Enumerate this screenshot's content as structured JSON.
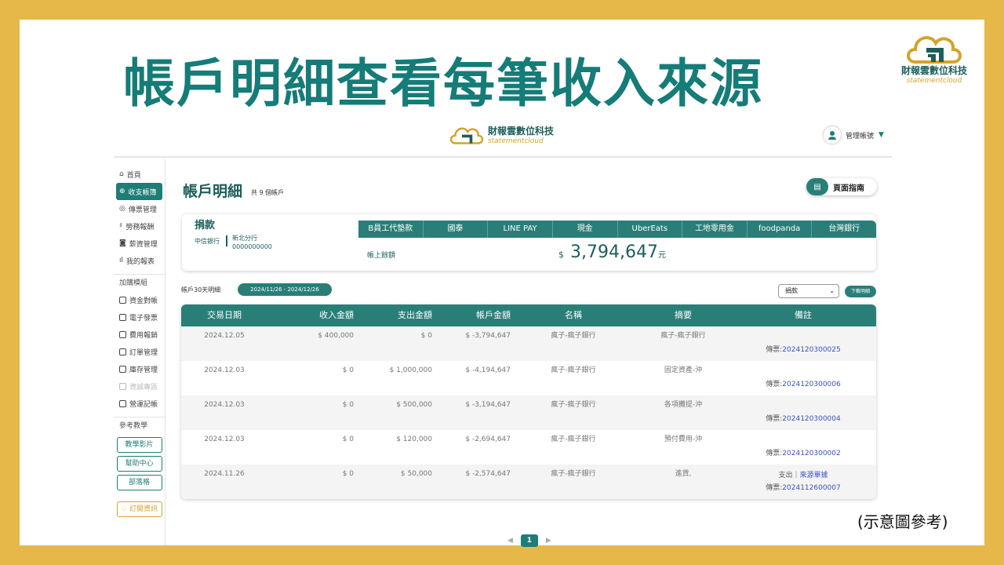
{
  "slide": {
    "headline": "帳戶明細查看每筆收入來源",
    "note": "(示意圖參考)"
  },
  "brand": {
    "name_zh": "財報雲數位科技",
    "name_en": "statementcloud"
  },
  "topbar": {
    "user_label": "管理帳號"
  },
  "sidebar": {
    "items": [
      {
        "label": "首頁"
      },
      {
        "label": "收支帳簿"
      },
      {
        "label": "傳票管理"
      },
      {
        "label": "勞務報酬"
      },
      {
        "label": "薪資管理"
      },
      {
        "label": "我的報表"
      }
    ],
    "section2": "加購模組",
    "modules": [
      {
        "label": "資金對帳"
      },
      {
        "label": "電子發票"
      },
      {
        "label": "費用報銷"
      },
      {
        "label": "訂單管理"
      },
      {
        "label": "庫存管理"
      },
      {
        "label": "資誠專區"
      },
      {
        "label": "營運記帳"
      }
    ],
    "section3": "參考教學",
    "buttons": [
      "教學影片",
      "幫助中心",
      "部落格"
    ],
    "subscribe": "訂閱資訊"
  },
  "page": {
    "title": "帳戶明細",
    "count": "共 9 個帳戶",
    "guide": "頁面指南",
    "guide_icon": "book-icon"
  },
  "account": {
    "name": "捐款",
    "bank": "中信銀行",
    "branch": "新北分行",
    "number": "0000000000",
    "tabs": [
      "B員工代墊款",
      "國泰",
      "LINE PAY",
      "現金",
      "UberEats",
      "工地零用金",
      "foodpanda",
      "台灣銀行"
    ],
    "balance_label": "帳上餘額",
    "currency": "$",
    "balance": "3,794,647",
    "unit": "元"
  },
  "filter": {
    "label": "帳戶30天明細",
    "range": "2024/11/26 - 2024/12/26",
    "select": "捐款",
    "download": "下載明細"
  },
  "table": {
    "headers": [
      "交易日期",
      "收入金額",
      "支出金額",
      "帳戶金額",
      "名稱",
      "摘要",
      "備註"
    ],
    "rows": [
      {
        "date": "2024.12.05",
        "income": "$ 400,000",
        "expense": "$ 0",
        "balance": "$ -3,794,647",
        "name": "瘋子-瘋子銀行",
        "summary": "瘋子-瘋子銀行",
        "memo_prefix": "傳票:",
        "memo_link": "2024120300025"
      },
      {
        "date": "2024.12.03",
        "income": "$ 0",
        "expense": "$ 1,000,000",
        "balance": "$ -4,194,647",
        "name": "瘋子-瘋子銀行",
        "summary": "固定資產-沖",
        "memo_prefix": "傳票:",
        "memo_link": "2024120300006"
      },
      {
        "date": "2024.12.03",
        "income": "$ 0",
        "expense": "$ 500,000",
        "balance": "$ -3,194,647",
        "name": "瘋子-瘋子銀行",
        "summary": "各項攤提-沖",
        "memo_prefix": "傳票:",
        "memo_link": "2024120300004"
      },
      {
        "date": "2024.12.03",
        "income": "$ 0",
        "expense": "$ 120,000",
        "balance": "$ -2,694,647",
        "name": "瘋子-瘋子銀行",
        "summary": "預付費用-沖",
        "memo_prefix": "傳票:",
        "memo_link": "2024120300002"
      },
      {
        "date": "2024.11.26",
        "income": "$ 0",
        "expense": "$ 50,000",
        "balance": "$ -2,574,647",
        "name": "瘋子-瘋子銀行",
        "summary": "進貨,",
        "memo_extra": "支出｜",
        "memo_extra_link": "來源單據",
        "memo_prefix": "傳票:",
        "memo_link": "2024112600007"
      }
    ]
  },
  "pager": {
    "current": "1",
    "prev": "◀",
    "next": "▶"
  }
}
